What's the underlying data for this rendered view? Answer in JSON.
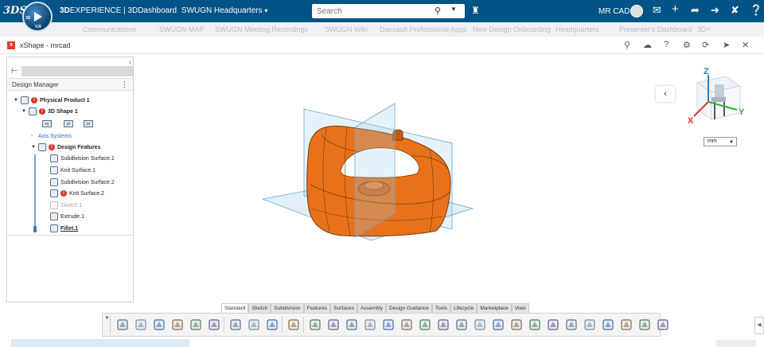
{
  "topbar": {
    "logo": "3DS",
    "compass": {
      "north": "3D",
      "west": "V,R",
      "east": "",
      "south": ""
    },
    "brand_prefix": "3D",
    "brand_main": "EXPERIENCE | 3DDashboard",
    "space": "SWUGN Headquarters",
    "space_chevron": "chevron-down-icon",
    "search_placeholder": "Search",
    "user_name": "MR CAD",
    "icons": [
      "tag-icon",
      "chat-icon",
      "plus-icon",
      "share-icon",
      "network-icon",
      "tools-icon",
      "help-icon"
    ]
  },
  "tabstrip": [
    "Communications",
    "SWUGN MAP",
    "SWUGN Meeting Recordings",
    "SWUGN Wiki",
    "Dassault Professional Apps",
    "New Design Onboarding",
    "Headquarters",
    "Presenter's Dashboard",
    "3D+"
  ],
  "app": {
    "title": "xShape - mrcad",
    "header_icons": [
      "search-icon",
      "cloud-icon",
      "help-icon",
      "gear-icon",
      "refresh-icon",
      "pin-icon",
      "close-icon"
    ]
  },
  "design_manager": {
    "label": "Design Manager",
    "tree": [
      {
        "label": "Physical Product 1",
        "bold": true,
        "error": true,
        "expanded": true
      },
      {
        "label": "3D Shape 1",
        "bold": true,
        "error": true,
        "expanded": true
      },
      {
        "label": "Axis Systems",
        "link": true
      },
      {
        "label": "Design Features",
        "bold": true,
        "error": true,
        "expanded": true
      },
      {
        "label": "Subdivision Surface.1"
      },
      {
        "label": "Knit Surface.1"
      },
      {
        "label": "Subdivision Surface.2"
      },
      {
        "label": "Knit Surface.2",
        "error": true
      },
      {
        "label": "Sketch.1",
        "dim": true
      },
      {
        "label": "Extrude.1"
      },
      {
        "label": "Fillet.1",
        "underline": true
      }
    ],
    "planes": [
      "xy",
      "yz",
      "zx"
    ]
  },
  "viewport": {
    "compass_axes": {
      "x": "X",
      "y": "Y",
      "z": "Z"
    },
    "unit": "mm",
    "colors": {
      "model": "#e8721c",
      "model_edge": "#7a3a08",
      "plane": "#9ccbe8",
      "x_axis": "#d9352a",
      "y_axis": "#3caa3c",
      "z_axis": "#2f7cc5"
    }
  },
  "toolbar": {
    "tabs": [
      "Standard",
      "Sketch",
      "Subdivision",
      "Features",
      "Surfaces",
      "Assembly",
      "Design Guidance",
      "Tools",
      "Lifecycle",
      "Marketplace",
      "View"
    ],
    "active_tab": "Standard",
    "tools": [
      "new-icon",
      "open-icon",
      "save-icon",
      "save-all-icon",
      "properties-icon",
      "settings-icon",
      "undo-icon",
      "redo-icon",
      "help-icon",
      "sketch-icon",
      "subdiv-box-icon",
      "subdiv-grid-icon",
      "subdiv-cube-icon",
      "surface-icon",
      "solid-icon",
      "sweep-icon",
      "extrude-face-icon",
      "loft-icon",
      "fill-icon",
      "split-icon",
      "thicken-icon",
      "cut-icon",
      "mirror-icon",
      "draft-icon",
      "sphere-icon",
      "blend-icon",
      "pattern-icon",
      "box-icon",
      "shell-icon",
      "chamfer-icon"
    ]
  }
}
